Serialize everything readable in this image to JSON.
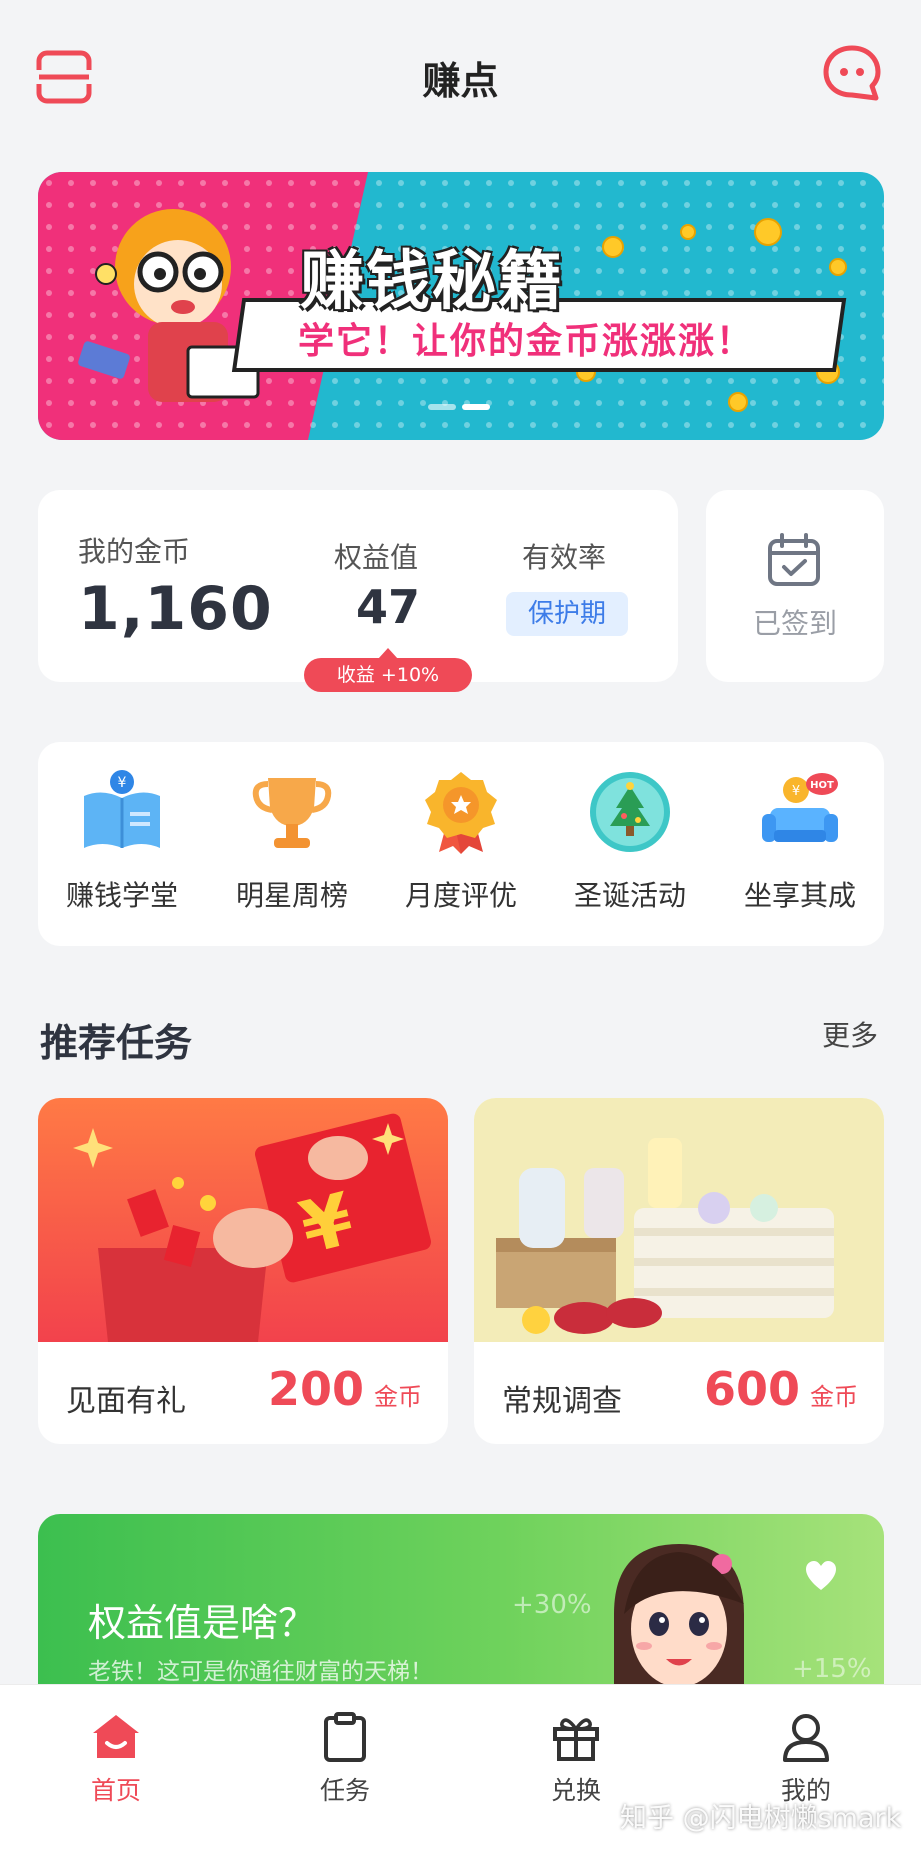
{
  "header": {
    "title": "赚点",
    "menu_icon": "scan-frame-icon",
    "chat_icon": "message-bubble-icon",
    "accent": "#ef4a57"
  },
  "banner": {
    "headline": "赚钱秘籍",
    "subline": "学它！让你的金币涨涨涨！",
    "slide_index": 1,
    "slide_count": 2
  },
  "stats": {
    "coins_label": "我的金币",
    "coins_value": "1,160",
    "equity_label": "权益值",
    "equity_value": "47",
    "efficiency_label": "有效率",
    "efficiency_value": "保护期",
    "gain_label": "收益  +10%"
  },
  "signin": {
    "label": "已签到",
    "icon": "calendar-check-icon"
  },
  "shortcuts": [
    {
      "label": "赚钱学堂",
      "icon": "book-coin-icon"
    },
    {
      "label": "明星周榜",
      "icon": "trophy-icon"
    },
    {
      "label": "月度评优",
      "icon": "medal-icon"
    },
    {
      "label": "圣诞活动",
      "icon": "christmas-tree-icon"
    },
    {
      "label": "坐享其成",
      "icon": "sofa-hot-icon"
    }
  ],
  "recommend": {
    "title": "推荐任务",
    "more": "更多",
    "tasks": [
      {
        "name": "见面有礼",
        "reward": "200",
        "unit": "金币"
      },
      {
        "name": "常规调查",
        "reward": "600",
        "unit": "金币"
      }
    ]
  },
  "promo": {
    "title": "权益值是啥？",
    "subtitle": "老铁！这可是你通往财富的天梯！",
    "tag1": "+30%",
    "tag2": "+15%"
  },
  "nav": {
    "items": [
      {
        "label": "首页",
        "icon": "home-icon",
        "active": true
      },
      {
        "label": "任务",
        "icon": "clipboard-icon",
        "active": false
      },
      {
        "label": "兑换",
        "icon": "gift-icon",
        "active": false
      },
      {
        "label": "我的",
        "icon": "user-icon",
        "active": false
      }
    ]
  },
  "watermark": "知乎 @闪电树懒smark"
}
